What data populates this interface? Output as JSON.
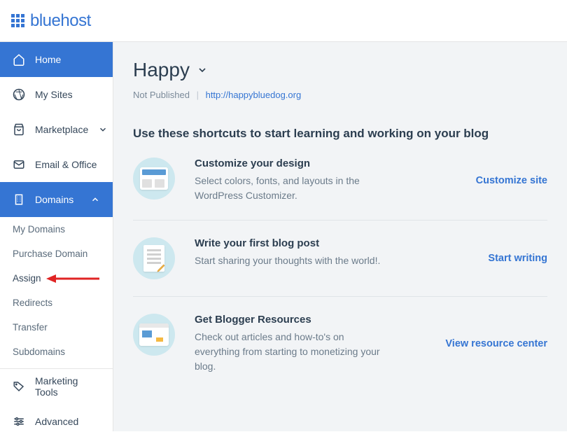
{
  "brand": "bluehost",
  "sidebar": {
    "items": [
      {
        "label": "Home",
        "active": true
      },
      {
        "label": "My Sites"
      },
      {
        "label": "Marketplace",
        "chevron": "down"
      },
      {
        "label": "Email & Office"
      },
      {
        "label": "Domains",
        "expanded": true,
        "chevron": "up"
      },
      {
        "label": "Marketing Tools"
      },
      {
        "label": "Advanced"
      }
    ],
    "domain_subitems": [
      {
        "label": "My Domains"
      },
      {
        "label": "Purchase Domain"
      },
      {
        "label": "Assign",
        "highlight": true
      },
      {
        "label": "Redirects"
      },
      {
        "label": "Transfer"
      },
      {
        "label": "Subdomains"
      }
    ]
  },
  "main": {
    "site_title": "Happy",
    "status": "Not Published",
    "url": "http://happybluedog.org",
    "shortcuts_heading": "Use these shortcuts to start learning and working on your blog",
    "shortcuts": [
      {
        "title": "Customize your design",
        "desc": "Select colors, fonts, and layouts in the WordPress Customizer.",
        "action": "Customize site"
      },
      {
        "title": "Write your first blog post",
        "desc": "Start sharing your thoughts with the world!.",
        "action": "Start writing"
      },
      {
        "title": "Get Blogger Resources",
        "desc": "Check out articles and how-to's on everything from starting to monetizing your blog.",
        "action": "View resource center"
      }
    ]
  }
}
